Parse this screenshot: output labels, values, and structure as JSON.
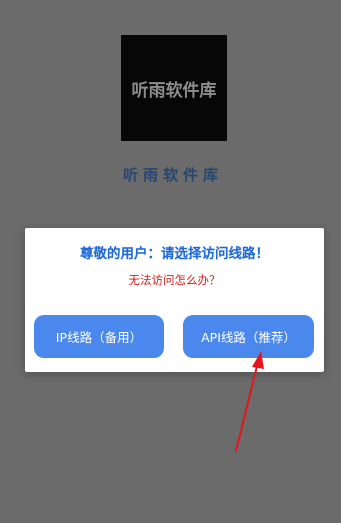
{
  "logo": {
    "text": "听雨软件库"
  },
  "app_name": "听雨软件库",
  "dialog": {
    "title": "尊敬的用户：请选择访问线路！",
    "help_link": "无法访问怎么办？",
    "buttons": {
      "ip_route": "IP线路（备用）",
      "api_route": "API线路（推荐）"
    }
  },
  "colors": {
    "background_overlay": "#6b6b6b",
    "logo_bg": "#070707",
    "title_blue": "#1f69d6",
    "help_red": "#d31d1d",
    "button_blue": "#4b88ee",
    "annotation_arrow": "#e3161b"
  },
  "annotation": {
    "icon": "red-arrow-icon"
  }
}
